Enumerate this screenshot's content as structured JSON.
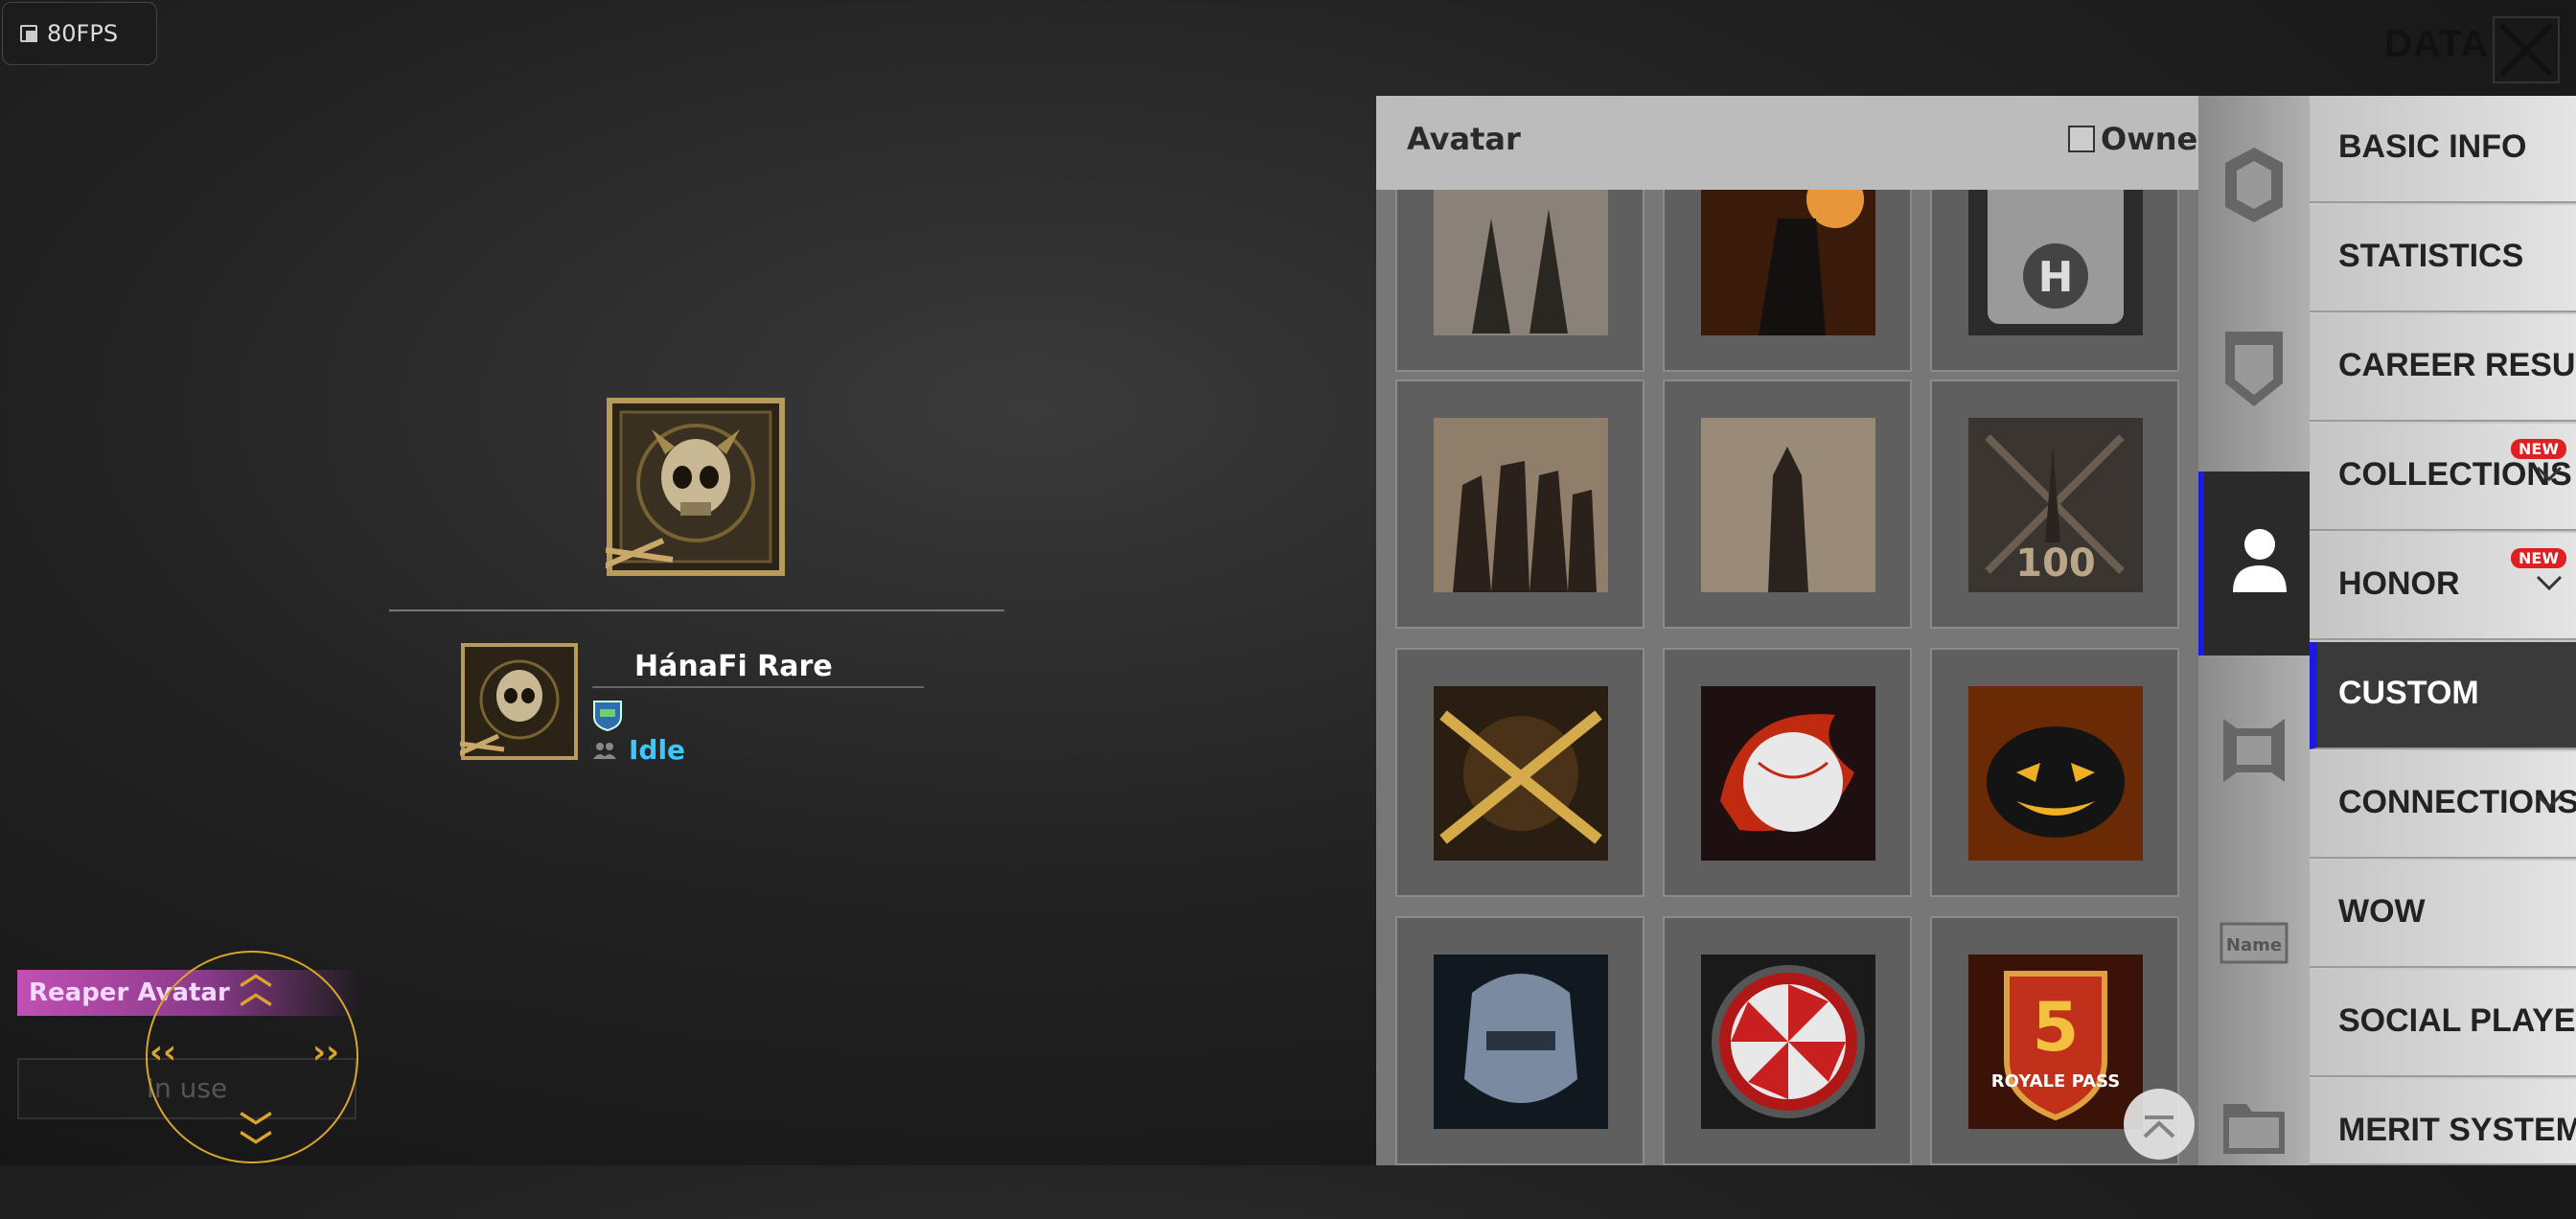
{
  "fps": "80FPS",
  "header": {
    "title": "DATA"
  },
  "preview": {
    "player_name": "HánaFi Rare",
    "status": "Idle",
    "item_name": "Reaper Avatar",
    "in_use_label": "In use"
  },
  "panel": {
    "title": "Avatar",
    "owned_label": "Owned",
    "avatars": [
      "squad-silhouette-avatar",
      "burning-soldier-avatar",
      "helipad-crate-avatar",
      "squad-team-avatar",
      "lone-soldier-avatar",
      "level-100-avatar",
      "crossed-rifles-avatar",
      "rooster-baseball-avatar",
      "pumpkin-avatar",
      "robot-helmet-avatar",
      "umbrella-avatar",
      "royale-pass-5-avatar"
    ],
    "avatar_labels": {
      "level_100": "100",
      "rp_number": "5",
      "rp_text": "ROYALE PASS"
    }
  },
  "categories": [
    {
      "name": "frame-icon",
      "label": ""
    },
    {
      "name": "badge-icon",
      "label": ""
    },
    {
      "name": "avatar-icon",
      "label": ""
    },
    {
      "name": "banner-icon",
      "label": ""
    },
    {
      "name": "name-tag-icon",
      "label": "Name"
    },
    {
      "name": "folder-icon",
      "label": ""
    }
  ],
  "menu": [
    {
      "label": "BASIC INFO",
      "badge": "",
      "chevron": false
    },
    {
      "label": "STATISTICS",
      "badge": "",
      "chevron": false
    },
    {
      "label": "CAREER RESULTS",
      "badge": "",
      "chevron": false
    },
    {
      "label": "COLLECTIONS",
      "badge": "NEW",
      "chevron": true
    },
    {
      "label": "HONOR",
      "badge": "NEW",
      "chevron": true
    },
    {
      "label": "CUSTOM",
      "badge": "",
      "chevron": false
    },
    {
      "label": "CONNECTIONS",
      "badge": "",
      "chevron": true
    },
    {
      "label": "WOW",
      "badge": "",
      "chevron": false
    },
    {
      "label": "SOCIAL PLAYER CA",
      "badge": "",
      "chevron": false
    },
    {
      "label": "MERIT SYSTEM",
      "badge": "",
      "chevron": false
    }
  ],
  "colors": {
    "accent": "#1a1ae0",
    "status": "#3ec6ff",
    "new_badge": "#e02020",
    "joystick": "#d9a52c"
  }
}
